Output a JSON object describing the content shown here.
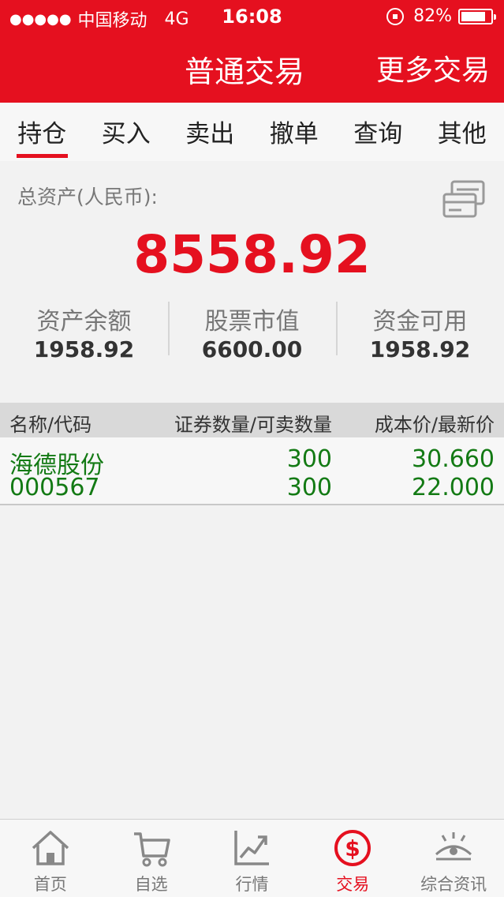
{
  "status_bar": {
    "signal_dots": "●●●●●",
    "carrier": "中国移动",
    "network": "4G",
    "time": "16:08",
    "battery": "82%",
    "battery_level": 0.82
  },
  "nav": {
    "title": "普通交易",
    "more_label": "更多交易"
  },
  "tabs": [
    "持仓",
    "买入",
    "卖出",
    "撤单",
    "查询",
    "其他"
  ],
  "active_tab": 0,
  "summary": {
    "total_label": "总资产(人民币):",
    "total_value": "8558.92",
    "metrics": [
      {
        "label": "资产余额",
        "value": "1958.92"
      },
      {
        "label": "股票市值",
        "value": "6600.00"
      },
      {
        "label": "资金可用",
        "value": "1958.92"
      }
    ]
  },
  "table": {
    "headers": {
      "name": "名称/代码",
      "qty": "证券数量/可卖数量",
      "price": "成本价/最新价"
    },
    "rows": [
      {
        "name": "海德股份",
        "code": "000567",
        "qty": "300",
        "sellable": "300",
        "cost": "30.660",
        "latest": "22.000"
      }
    ]
  },
  "bottom_nav": [
    {
      "label": "首页",
      "icon": "home-icon"
    },
    {
      "label": "自选",
      "icon": "cart-icon"
    },
    {
      "label": "行情",
      "icon": "trend-chart-icon"
    },
    {
      "label": "交易",
      "icon": "dollar-circle-icon"
    },
    {
      "label": "综合资讯",
      "icon": "eye-info-icon"
    }
  ],
  "active_bottom_nav": 3,
  "colors": {
    "brand_red": "#e5101f",
    "gain_green": "#137a14",
    "muted_gray": "#777777"
  }
}
